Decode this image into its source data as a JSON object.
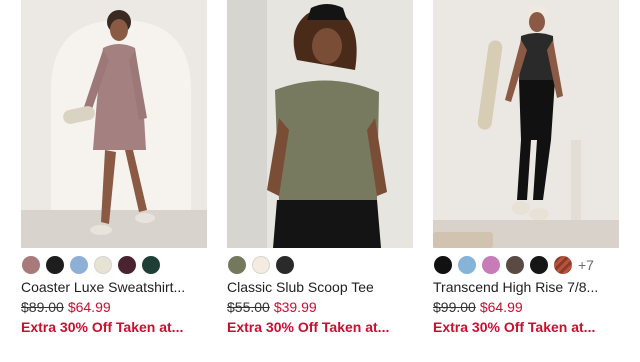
{
  "products": [
    {
      "name": "Coaster Luxe Sweatshirt...",
      "original_price": "$89.00",
      "sale_price": "$64.99",
      "promo": "Extra 30% Off Taken at...",
      "swatches": [
        "#a87a7a",
        "#1d1d1d",
        "#8fb0d6",
        "#e6e2d4",
        "#4a2330",
        "#1f3f36"
      ],
      "more_colors": ""
    },
    {
      "name": "Classic Slub Scoop Tee",
      "original_price": "$55.00",
      "sale_price": "$39.99",
      "promo": "Extra 30% Off Taken at...",
      "swatches": [
        "#74785c",
        "#f4ece0",
        "#2a2a2a"
      ],
      "more_colors": ""
    },
    {
      "name": "Transcend High Rise 7/8...",
      "original_price": "$99.00",
      "sale_price": "$64.99",
      "promo": "Extra 30% Off Taken at...",
      "swatches": [
        "#111111",
        "#86b4d9",
        "#c77bb8",
        "#5a4a44",
        "#161616",
        "#b4543a"
      ],
      "more_colors": "+7"
    }
  ],
  "colors": {
    "sale": "#c8102e",
    "text": "#1f1f1f"
  }
}
